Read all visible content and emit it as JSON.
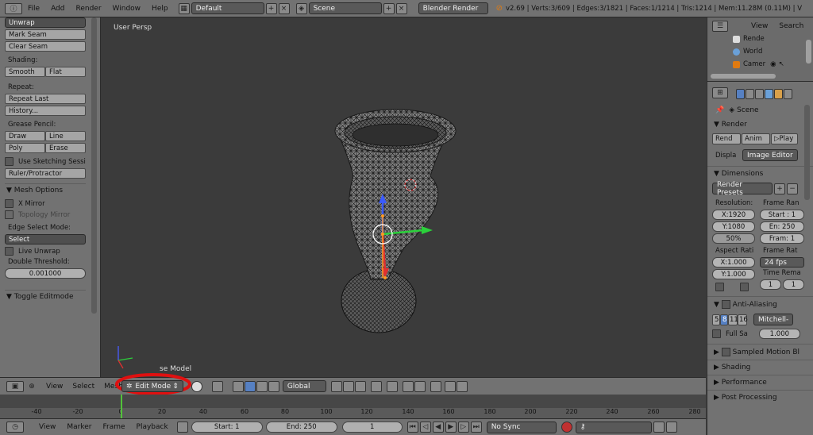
{
  "topbar": {
    "menus": [
      "File",
      "Add",
      "Render",
      "Window",
      "Help"
    ],
    "layout": "Default",
    "scene": "Scene",
    "engine": "Blender Render",
    "stats": "v2.69 | Verts:3/609 | Edges:3/1821 | Faces:1/1214 | Tris:1214 | Mem:11.28M (0.11M) | V"
  },
  "tools": {
    "unwrap": "Unwrap",
    "mark_seam": "Mark Seam",
    "clear_seam": "Clear Seam",
    "shading_label": "Shading:",
    "smooth": "Smooth",
    "flat": "Flat",
    "repeat_label": "Repeat:",
    "repeat_last": "Repeat Last",
    "history": "History...",
    "grease_label": "Grease Pencil:",
    "draw": "Draw",
    "line": "Line",
    "poly": "Poly",
    "erase": "Erase",
    "use_sketching": "Use Sketching Sessi",
    "ruler": "Ruler/Protractor",
    "mesh_options": "Mesh Options",
    "x_mirror": "X Mirror",
    "topology_mirror": "Topology Mirror",
    "edge_select_label": "Edge Select Mode:",
    "edge_select_value": "Select",
    "live_unwrap": "Live Unwrap",
    "double_threshold_label": "Double Threshold:",
    "double_threshold_value": "0.001000",
    "toggle_editmode": "Toggle Editmode"
  },
  "viewport": {
    "label": "User Persp",
    "object_label": "se Model"
  },
  "view_header": {
    "menus": [
      "View",
      "Select",
      "Mesh"
    ],
    "mode": "Edit Mode",
    "orientation": "Global"
  },
  "timeline": {
    "ticks": [
      "-40",
      "-20",
      "0",
      "20",
      "40",
      "60",
      "80",
      "100",
      "120",
      "140",
      "160",
      "180",
      "200",
      "220",
      "240",
      "260",
      "280"
    ],
    "menus": [
      "View",
      "Marker",
      "Frame",
      "Playback"
    ],
    "start": "Start: 1",
    "end": "End: 250",
    "current": "1",
    "sync": "No Sync"
  },
  "outliner": {
    "view": "View",
    "search": "Search",
    "items": [
      "Rende",
      "World",
      "Camer"
    ]
  },
  "properties": {
    "scene": "Scene",
    "render_section": "Render",
    "render_btn": "Rend",
    "anim_btn": "Anim",
    "play_btn": "Play",
    "display_label": "Displa",
    "display_value": "Image Editor",
    "dimensions_section": "Dimensions",
    "presets": "Render Presets",
    "resolution_label": "Resolution:",
    "res_x": "1920",
    "res_y": "1080",
    "res_pct": "50%",
    "frame_range_label": "Frame Ran",
    "frame_start": "Start : 1",
    "frame_end": "En: 250",
    "frame_step": "Fram: 1",
    "aspect_label": "Aspect Rati",
    "aspect_x": "1.000",
    "aspect_y": "1.000",
    "frame_rate_label": "Frame Rat",
    "fps": "24 fps",
    "time_remap_label": "Time Rema",
    "remap_old": "1",
    "remap_new": "1",
    "aa_section": "Anti-Aliasing",
    "aa_samples": [
      "5",
      "8",
      "11",
      "16"
    ],
    "aa_filter": "Mitchell-",
    "full_sample": "Full Sa",
    "aa_size": "1.000",
    "sampled_motion": "Sampled Motion Bl",
    "shading": "Shading",
    "performance": "Performance",
    "post_processing": "Post Processing"
  },
  "colors": {
    "panel": "#727272",
    "viewport_bg": "#3b3b3b",
    "accent_blue": "#5680c2",
    "annotation_red": "#e01010"
  }
}
